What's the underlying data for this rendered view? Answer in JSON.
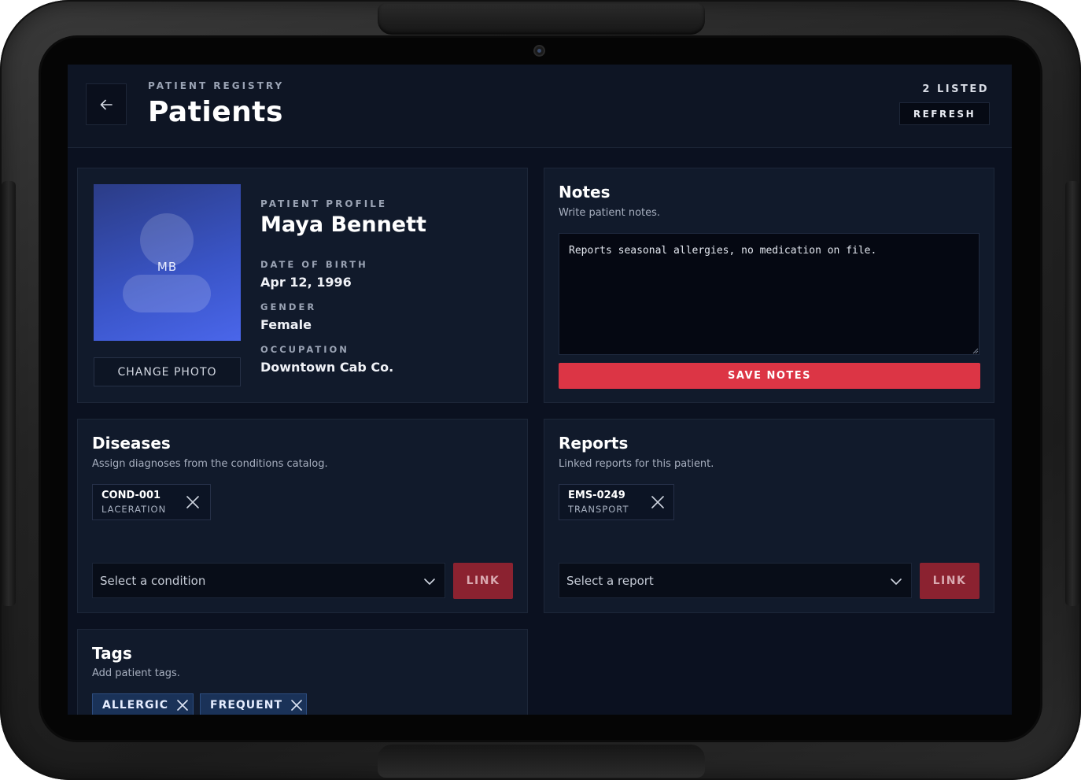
{
  "header": {
    "eyebrow": "PATIENT REGISTRY",
    "title": "Patients",
    "listed": "2 LISTED",
    "refresh_label": "REFRESH"
  },
  "profile": {
    "eyebrow": "PATIENT PROFILE",
    "initials": "MB",
    "change_photo_label": "CHANGE PHOTO",
    "name": "Maya Bennett",
    "fields": [
      {
        "label": "DATE OF BIRTH",
        "value": "Apr 12, 1996"
      },
      {
        "label": "GENDER",
        "value": "Female"
      },
      {
        "label": "OCCUPATION",
        "value": "Downtown Cab Co."
      }
    ]
  },
  "notes": {
    "title": "Notes",
    "subtitle": "Write patient notes.",
    "value": "Reports seasonal allergies, no medication on file.",
    "save_label": "SAVE NOTES"
  },
  "diseases": {
    "title": "Diseases",
    "subtitle": "Assign diagnoses from the conditions catalog.",
    "chips": [
      {
        "code": "COND-001",
        "label": "LACERATION"
      }
    ],
    "select_placeholder": "Select a condition",
    "link_label": "LINK"
  },
  "reports": {
    "title": "Reports",
    "subtitle": "Linked reports for this patient.",
    "chips": [
      {
        "code": "EMS-0249",
        "label": "TRANSPORT"
      }
    ],
    "select_placeholder": "Select a report",
    "link_label": "LINK"
  },
  "tags": {
    "title": "Tags",
    "subtitle": "Add patient tags.",
    "items": [
      {
        "label": "ALLERGIC"
      },
      {
        "label": "FREQUENT"
      }
    ]
  },
  "colors": {
    "screen_bg": "#0b1120",
    "card_bg": "#111a2b",
    "accent_red": "#dc3545",
    "link_red": "#8b2230",
    "tag_blue": "#1a3258"
  }
}
